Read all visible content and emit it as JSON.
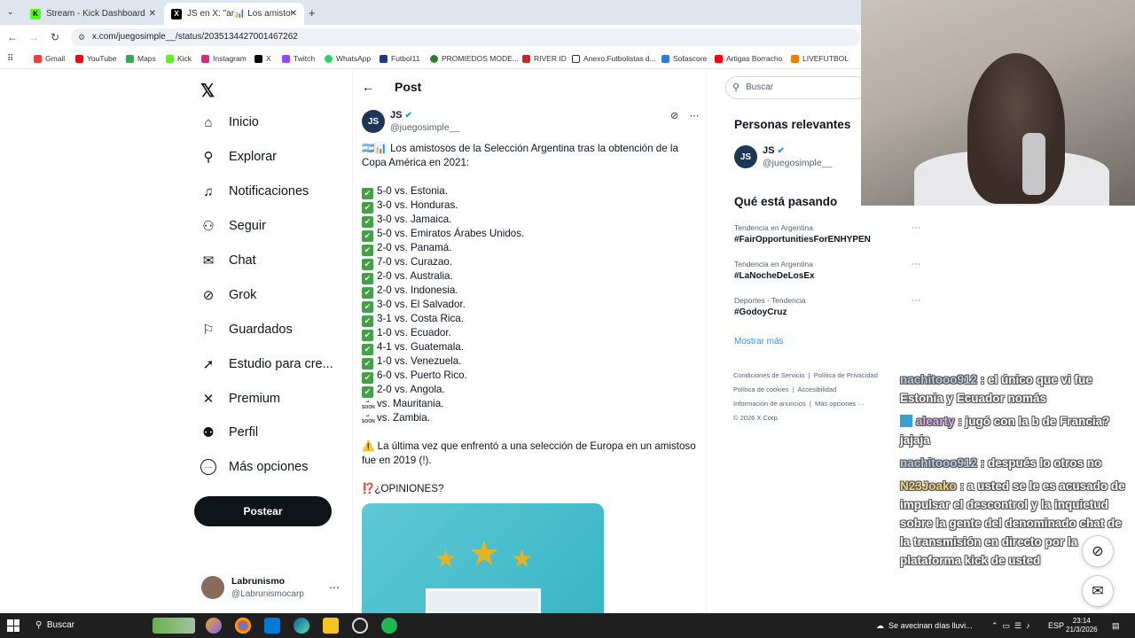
{
  "browser": {
    "tabs": [
      {
        "title": "Stream - Kick Dashboard",
        "active": false
      },
      {
        "title": "JS en X: \"ar📊 Los amistosos d",
        "active": true
      }
    ],
    "url": "x.com/juegosimple__/status/2035134427001467262",
    "bookmarks": [
      "Gmail",
      "YouTube",
      "Maps",
      "Kick",
      "Instagram",
      "X",
      "Twitch",
      "WhatsApp",
      "Futbol11",
      "PROMIEDOS MODE...",
      "RIVER ID",
      "Anexo:Futbolistas d...",
      "Sofascore",
      "Artigas Borracho",
      "LIVEFUTBOL"
    ]
  },
  "sidebar": {
    "items": [
      {
        "label": "Inicio",
        "icon": "home-icon",
        "glyph": "⌂"
      },
      {
        "label": "Explorar",
        "icon": "search-icon",
        "glyph": "⚲"
      },
      {
        "label": "Notificaciones",
        "icon": "bell-icon",
        "glyph": "♫"
      },
      {
        "label": "Seguir",
        "icon": "follow-icon",
        "glyph": "⚇"
      },
      {
        "label": "Chat",
        "icon": "mail-icon",
        "glyph": "✉"
      },
      {
        "label": "Grok",
        "icon": "grok-icon",
        "glyph": "⊘"
      },
      {
        "label": "Guardados",
        "icon": "bookmark-icon",
        "glyph": "⚐"
      },
      {
        "label": "Estudio para cre...",
        "icon": "rocket-icon",
        "glyph": "➚"
      },
      {
        "label": "Premium",
        "icon": "x-premium-icon",
        "glyph": "✕"
      },
      {
        "label": "Perfil",
        "icon": "profile-icon",
        "glyph": "⚉"
      },
      {
        "label": "Más opciones",
        "icon": "more-icon",
        "glyph": "⋯"
      }
    ],
    "post_button": "Postear",
    "profile": {
      "name": "Labrunismo",
      "handle": "@Labrunismocarp"
    }
  },
  "post": {
    "header": "Post",
    "author": {
      "name": "JS",
      "handle": "@juegosimple__",
      "avatar": "JS"
    },
    "intro": "🇦🇷📊 Los amistosos de la Selección Argentina tras la obtención de la Copa América en 2021:",
    "results": [
      "5-0 vs. Estonia.",
      "3-0 vs. Honduras.",
      "3-0 vs. Jamaica.",
      "5-0 vs. Emiratos Árabes Unidos.",
      "2-0 vs. Panamá.",
      "7-0 vs. Curazao.",
      "2-0 vs. Australia.",
      "2-0 vs. Indonesia.",
      "3-0 vs. El Salvador.",
      "3-1 vs. Costa Rica.",
      "1-0 vs. Ecuador.",
      "4-1 vs. Guatemala.",
      "1-0 vs. Venezuela.",
      "6-0 vs. Puerto Rico.",
      "2-0 vs. Angola."
    ],
    "upcoming": [
      "vs. Mauritania.",
      "vs. Zambia."
    ],
    "warning": "⚠️ La última vez que enfrentó a una selección de Europa en un amistoso fue en 2019 (!).",
    "question": "⁉️¿OPINIONES?"
  },
  "right": {
    "search_placeholder": "Buscar",
    "relevant_title": "Personas relevantes",
    "relevant": {
      "name": "JS",
      "handle": "@juegosimple__"
    },
    "trending_title": "Qué está pasando",
    "trends": [
      {
        "context": "Tendencia en Argentina",
        "tag": "#FairOpportunitiesForENHYPEN"
      },
      {
        "context": "Tendencia en Argentina",
        "tag": "#LaNocheDeLosEx"
      },
      {
        "context": "Deportes · Tendencia",
        "tag": "#GodoyCruz"
      }
    ],
    "show_more": "Mostrar más",
    "footer": [
      "Condiciones de Servicio",
      "Política de Privacidad",
      "Política de cookies",
      "Accesibilidad",
      "Información de anuncios",
      "Más opciones ···",
      "© 2026 X Corp."
    ]
  },
  "chat": [
    {
      "user": "nachitooo912",
      "text": ": el único que vi fue Estonia y Ecuador nomás"
    },
    {
      "user": "alearty",
      "text": ": jugó con la b de Francia? jajaja"
    },
    {
      "user": "nachitooo912",
      "text": ": después lo otros no"
    },
    {
      "user": "N23Joako",
      "text": ": a usted se le es acusado de impulsar el descontrol y la inquietud sobre la gente del denominado chat de la transmisión en directo por la plataforma kick de usted"
    }
  ],
  "taskbar": {
    "search": "Buscar",
    "weather": "Se avecinan días lluvi...",
    "lang": "ESP",
    "time": "23:14",
    "date": "21/3/2026"
  }
}
